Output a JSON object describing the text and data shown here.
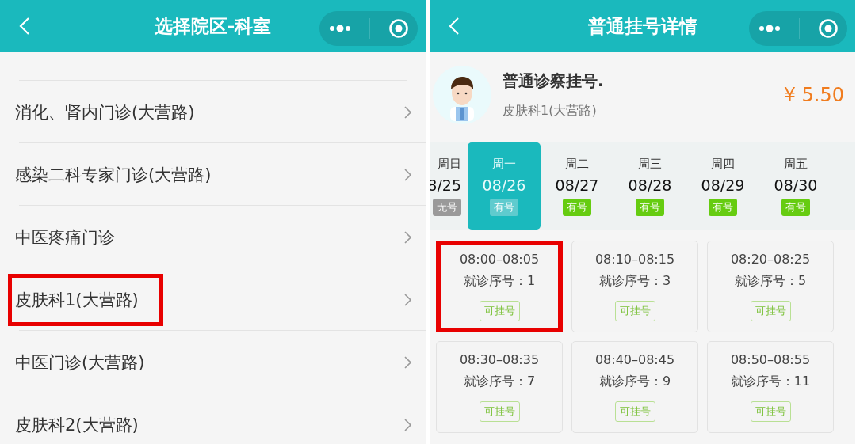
{
  "left_screen": {
    "header": {
      "title": "选择院区-科室"
    },
    "items": [
      {
        "label": "消化、肾内门诊(大营路)",
        "highlighted": false
      },
      {
        "label": "感染二科专家门诊(大营路)",
        "highlighted": false
      },
      {
        "label": "中医疼痛门诊",
        "highlighted": false
      },
      {
        "label": "皮肤科1(大营路)",
        "highlighted": true
      },
      {
        "label": "中医门诊(大营路)",
        "highlighted": false
      },
      {
        "label": "皮肤科2(大营路)",
        "highlighted": false
      }
    ]
  },
  "right_screen": {
    "header": {
      "title": "普通挂号详情"
    },
    "service": {
      "title": "普通诊察挂号.",
      "department": "皮肤科1(大营路)",
      "price": "¥ 5.50"
    },
    "days": [
      {
        "weekday": "周日",
        "date": "8/25",
        "badge": "无号",
        "available": false,
        "selected": false
      },
      {
        "weekday": "周一",
        "date": "08/26",
        "badge": "有号",
        "available": true,
        "selected": true
      },
      {
        "weekday": "周二",
        "date": "08/27",
        "badge": "有号",
        "available": true,
        "selected": false
      },
      {
        "weekday": "周三",
        "date": "08/28",
        "badge": "有号",
        "available": true,
        "selected": false
      },
      {
        "weekday": "周四",
        "date": "08/29",
        "badge": "有号",
        "available": true,
        "selected": false
      },
      {
        "weekday": "周五",
        "date": "08/30",
        "badge": "有号",
        "available": true,
        "selected": false
      }
    ],
    "slots": [
      {
        "time": "08:00–08:05",
        "number": "就诊序号：1",
        "status": "可挂号",
        "highlighted": true
      },
      {
        "time": "08:10–08:15",
        "number": "就诊序号：3",
        "status": "可挂号",
        "highlighted": false
      },
      {
        "time": "08:20–08:25",
        "number": "就诊序号：5",
        "status": "可挂号",
        "highlighted": false
      },
      {
        "time": "08:30–08:35",
        "number": "就诊序号：7",
        "status": "可挂号",
        "highlighted": false
      },
      {
        "time": "08:40–08:45",
        "number": "就诊序号：9",
        "status": "可挂号",
        "highlighted": false
      },
      {
        "time": "08:50–08:55",
        "number": "就诊序号：11",
        "status": "可挂号",
        "highlighted": false
      }
    ]
  }
}
